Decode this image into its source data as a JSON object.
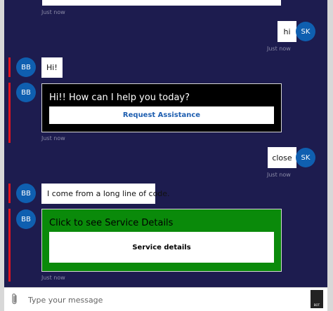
{
  "chat": {
    "timestamp": "Just now",
    "user_initials": "SK",
    "bot_initials": "BB",
    "msg1_text": "hi",
    "msg2_text": "Hi!",
    "card1": {
      "title": "Hi!! How can I help you today?",
      "button": "Request Assistance"
    },
    "msg3_text": "close",
    "msg4_text": "I come from a long line of code.",
    "card2": {
      "title": "Click to see Service Details",
      "button": "Service details"
    }
  },
  "input": {
    "placeholder": "Type your message",
    "bot_icon_label": "BOT"
  },
  "colors": {
    "background": "#1d1c4f",
    "accent_red": "#e3131e",
    "avatar_blue": "#0f5fb0",
    "card1_bg": "#000000",
    "card2_bg": "#0a8a0a",
    "link_blue": "#1f5fb0"
  },
  "icons": {
    "attach": "paperclip-icon",
    "bot": "bot-avatar-icon"
  }
}
